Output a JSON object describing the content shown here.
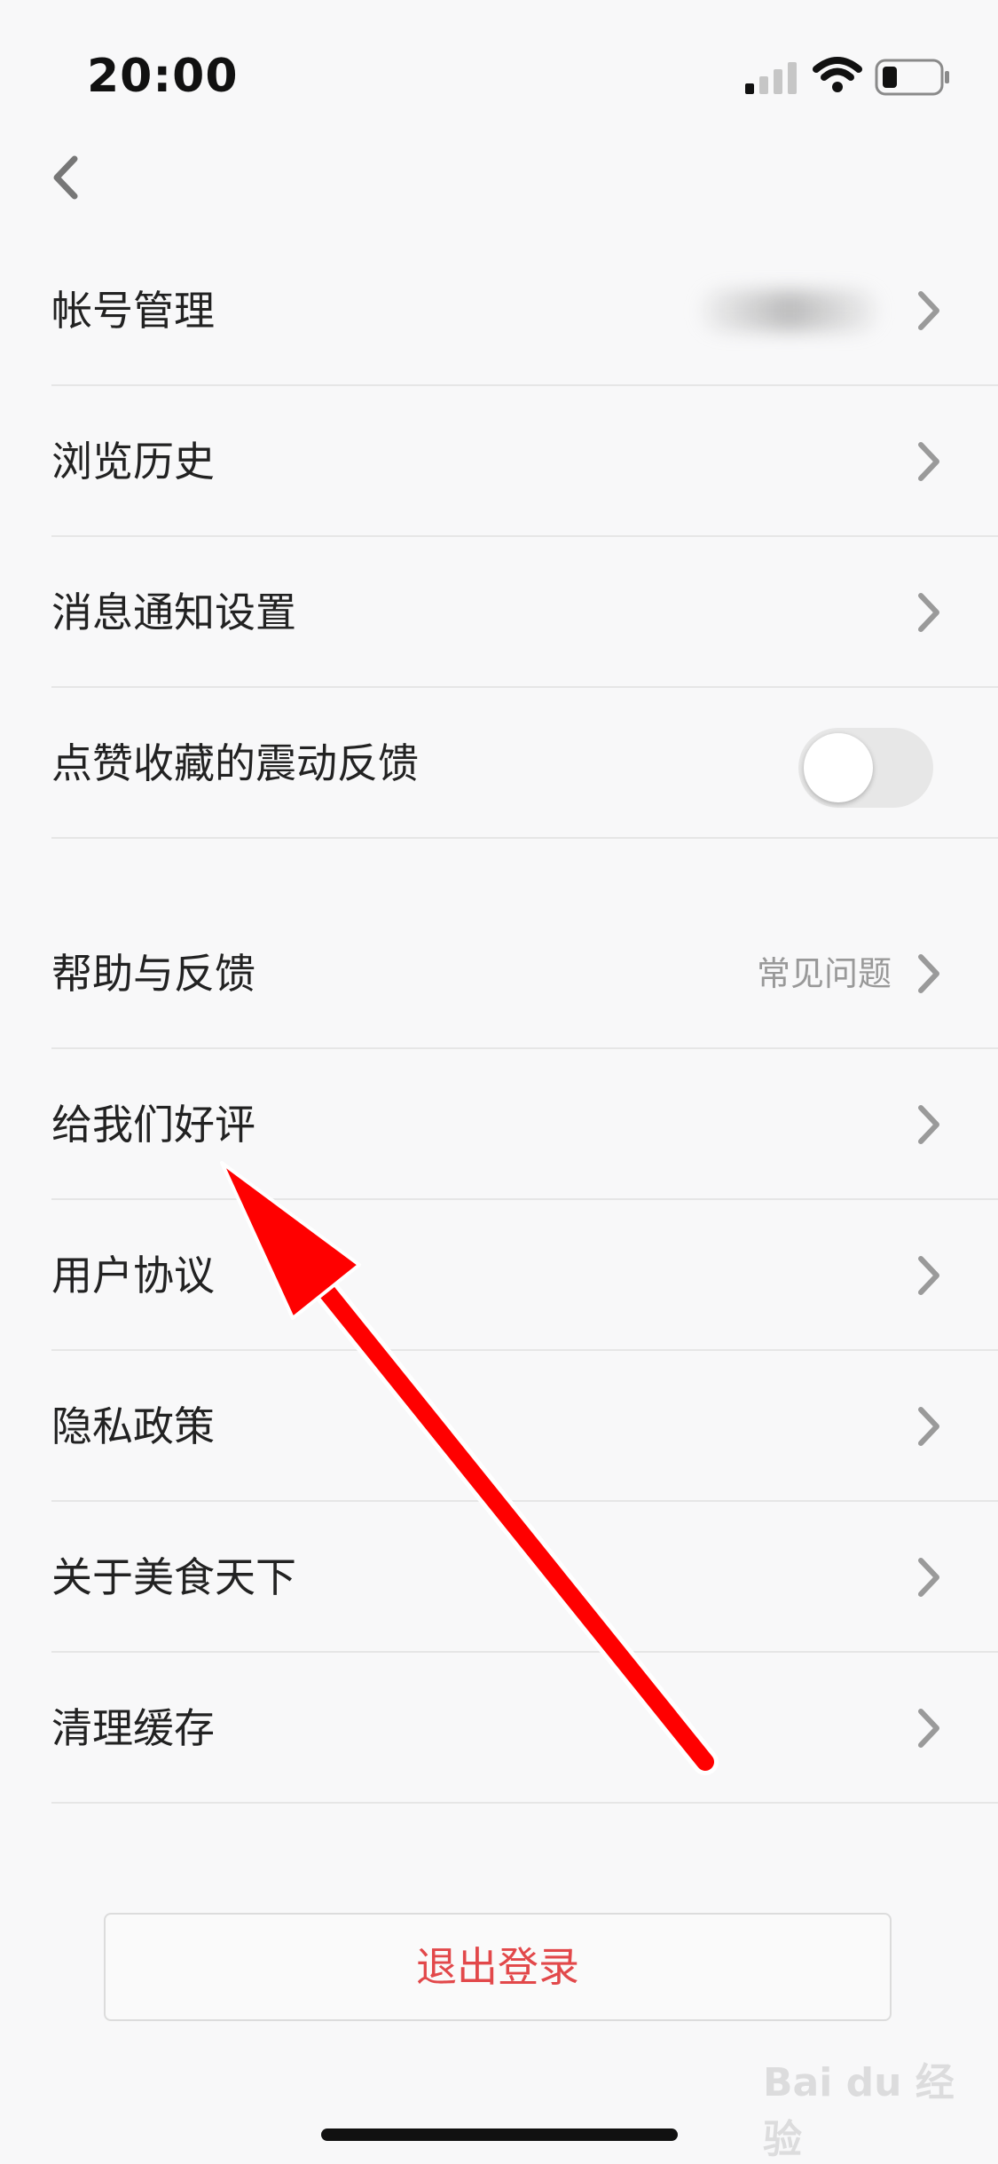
{
  "status_bar": {
    "time": "20:00"
  },
  "settings": {
    "account": {
      "label": "帐号管理"
    },
    "history": {
      "label": "浏览历史"
    },
    "notifications": {
      "label": "消息通知设置"
    },
    "vibration": {
      "label": "点赞收藏的震动反馈",
      "enabled": false
    },
    "help": {
      "label": "帮助与反馈",
      "value": "常见问题"
    },
    "rate": {
      "label": "给我们好评"
    },
    "agreement": {
      "label": "用户协议"
    },
    "privacy": {
      "label": "隐私政策"
    },
    "about": {
      "label": "关于美食天下"
    },
    "cache": {
      "label": "清理缓存"
    }
  },
  "logout": {
    "label": "退出登录"
  },
  "watermark": {
    "text": "Bai du 经验"
  }
}
